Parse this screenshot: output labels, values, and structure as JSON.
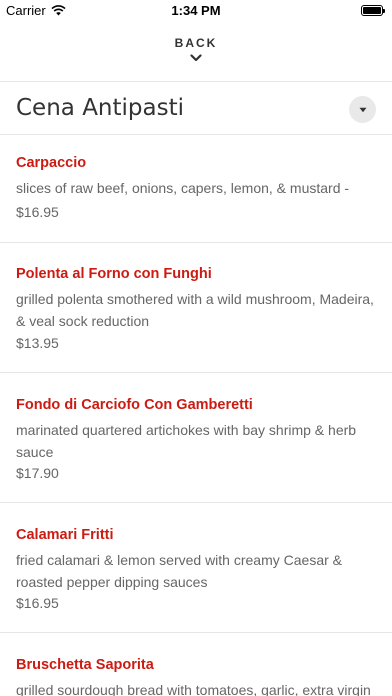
{
  "status_bar": {
    "carrier": "Carrier",
    "time": "1:34 PM"
  },
  "nav": {
    "back_label": "BACK"
  },
  "header": {
    "title": "Cena Antipasti"
  },
  "items": [
    {
      "name": "Carpaccio",
      "description": "slices of raw beef, onions, capers, lemon, & mustard -",
      "price": "$16.95"
    },
    {
      "name": "Polenta al Forno con Funghi",
      "description": "grilled polenta smothered with a wild mushroom, Madeira, & veal sock reduction",
      "price": "$13.95"
    },
    {
      "name": "Fondo di Carciofo Con Gamberetti",
      "description": "marinated quartered artichokes with bay shrimp & herb sauce",
      "price": "$17.90"
    },
    {
      "name": "Calamari Fritti",
      "description": "fried calamari & lemon served with creamy Caesar & roasted pepper dipping sauces",
      "price": "$16.95"
    },
    {
      "name": "Bruschetta Saporita",
      "description": "grilled sourdough bread with tomatoes, garlic, extra virgin",
      "price": ""
    }
  ],
  "colors": {
    "accent": "#cc1b12",
    "text": "#333333",
    "muted": "#666666",
    "divider": "#e6e6e6"
  }
}
